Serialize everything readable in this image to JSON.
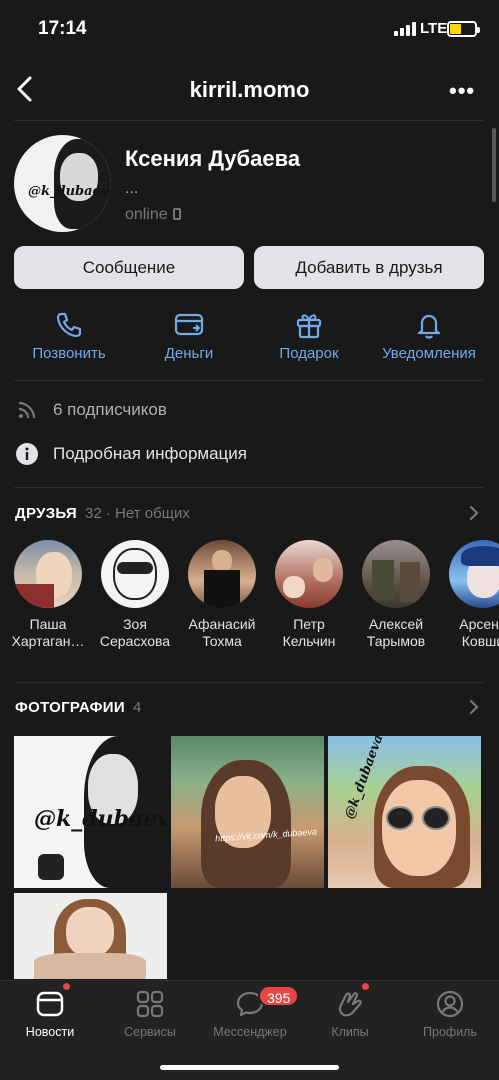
{
  "status_bar": {
    "time": "17:14",
    "network": "LTE"
  },
  "header": {
    "title": "kirril.momo",
    "back_icon": "chevron-left-icon",
    "more_icon": "more-horizontal-icon"
  },
  "profile": {
    "avatar_caption": "@k_dubaeva",
    "name": "Ксения Дубаева",
    "status": "...",
    "online": "online"
  },
  "buttons": {
    "message": "Сообщение",
    "add_friend": "Добавить в друзья"
  },
  "actions": [
    {
      "label": "Позвонить",
      "icon": "phone-icon"
    },
    {
      "label": "Деньги",
      "icon": "money-transfer-icon"
    },
    {
      "label": "Подарок",
      "icon": "gift-icon"
    },
    {
      "label": "Уведомления",
      "icon": "bell-icon"
    }
  ],
  "info": {
    "followers": "6 подписчиков",
    "details": "Подробная информация"
  },
  "friends": {
    "title": "ДРУЗЬЯ",
    "count": "32 · Нет общих",
    "items": [
      {
        "name": "Паша\nХартаган…"
      },
      {
        "name": "Зоя\nСерасхова"
      },
      {
        "name": "Афанасий\nТохма"
      },
      {
        "name": "Петр\nКельчин"
      },
      {
        "name": "Алексей\nТарымов"
      },
      {
        "name": "Арсени\nКовши"
      }
    ]
  },
  "photos": {
    "title": "ФОТОГРАФИИ",
    "count": "4",
    "captions": [
      "@k_dubaeva",
      "https://vk.com/k_dubaeva",
      "@k_dubaeva"
    ]
  },
  "tabbar": {
    "items": [
      {
        "label": "Новости",
        "icon": "news-icon",
        "active": true
      },
      {
        "label": "Сервисы",
        "icon": "services-grid-icon"
      },
      {
        "label": "Мессенджер",
        "icon": "messenger-icon"
      },
      {
        "label": "Клипы",
        "icon": "clips-icon"
      },
      {
        "label": "Профиль",
        "icon": "profile-icon"
      }
    ],
    "messenger_badge": "395"
  },
  "colors": {
    "background": "#19191a",
    "accent": "#71aaeb",
    "badge": "#e64646",
    "button": "#e1e3e6"
  }
}
